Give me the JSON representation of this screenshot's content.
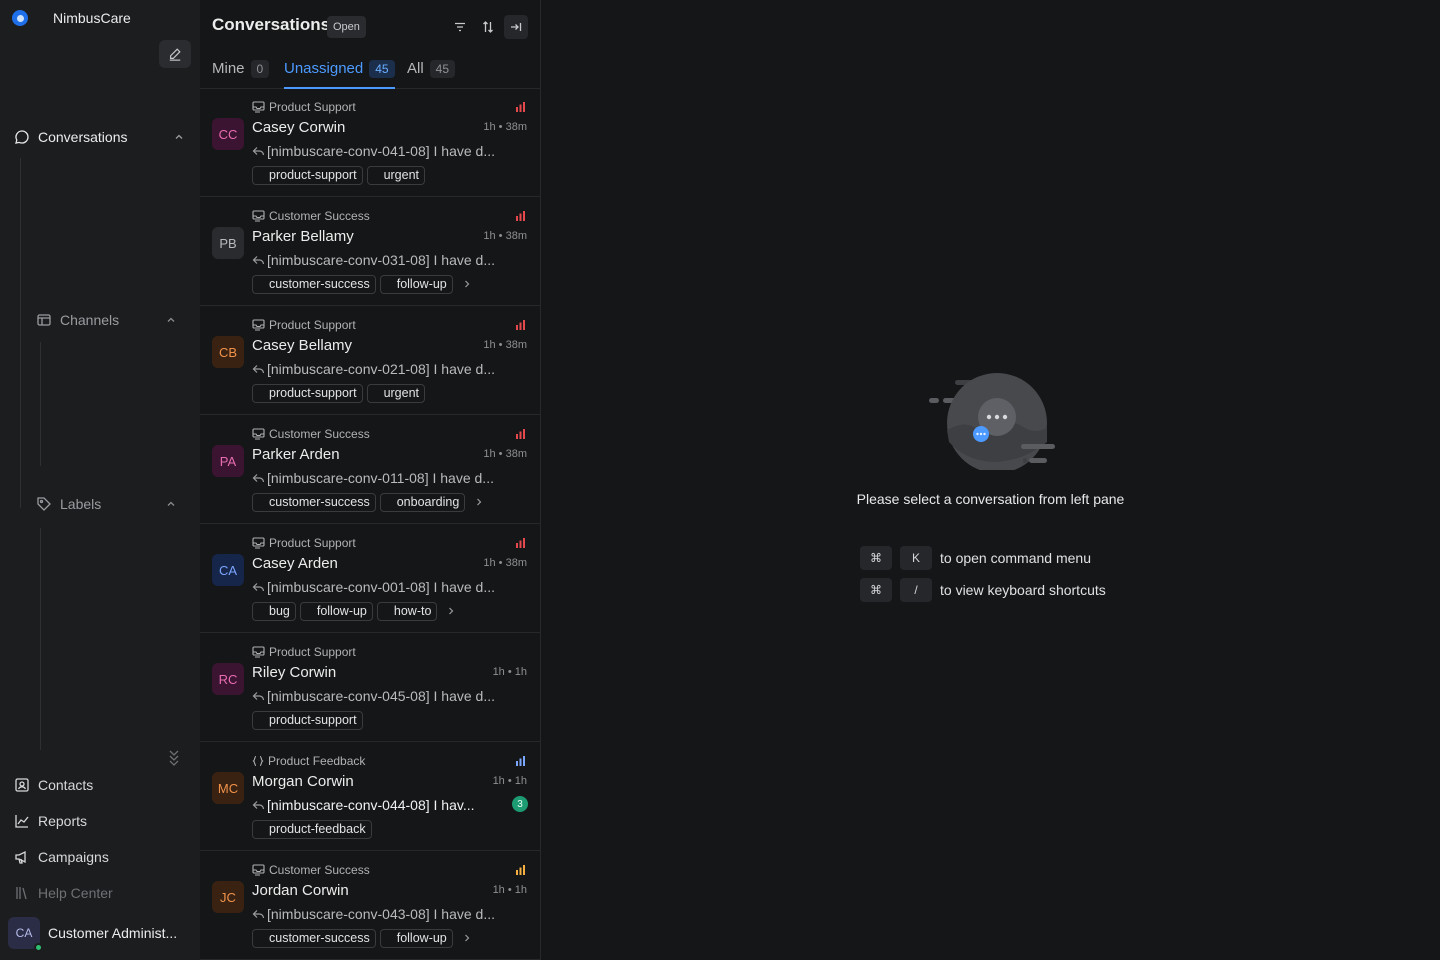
{
  "app": {
    "name": "NimbusCare"
  },
  "sidebar": {
    "compose_icon": "pencil-square-icon",
    "primary_nav": {
      "label": "Conversations",
      "icon": "chat-bubble-icon"
    },
    "groups": [
      {
        "label": "Channels",
        "icon": "inbox-icon"
      },
      {
        "label": "Labels",
        "icon": "tag-icon"
      }
    ],
    "nav_items": [
      {
        "label": "Contacts",
        "icon": "contacts-icon"
      },
      {
        "label": "Reports",
        "icon": "chart-line-icon"
      },
      {
        "label": "Campaigns",
        "icon": "megaphone-icon"
      },
      {
        "label": "Help Center",
        "icon": "library-icon"
      }
    ],
    "profile": {
      "initials": "CA",
      "name": "Customer Administ...",
      "status_color": "#2fbf71"
    }
  },
  "conversations_panel": {
    "title": "Conversations",
    "status": "Open",
    "header_icons": [
      "filter-icon",
      "sort-icon",
      "collapse-panel-icon"
    ],
    "tabs": [
      {
        "label": "Mine",
        "count": "0"
      },
      {
        "label": "Unassigned",
        "count": "45",
        "active": true
      },
      {
        "label": "All",
        "count": "45"
      }
    ],
    "items": [
      {
        "initials": "CC",
        "avatar_bg": "#3a1430",
        "avatar_fg": "#e86cb1",
        "inbox": "Product Support",
        "inbox_icon": "email-inbox-icon",
        "priority_color": "#e5484d",
        "name": "Casey Corwin",
        "time": "1h • 38m",
        "preview": "[nimbuscare-conv-041-08] I have d...",
        "labels": [
          "product-support",
          "urgent"
        ],
        "has_more": false,
        "unread": ""
      },
      {
        "initials": "PB",
        "avatar_bg": "#2a2b2e",
        "avatar_fg": "#b8babd",
        "inbox": "Customer Success",
        "inbox_icon": "email-inbox-icon",
        "priority_color": "#e5484d",
        "name": "Parker Bellamy",
        "time": "1h • 38m",
        "preview": "[nimbuscare-conv-031-08] I have d...",
        "labels": [
          "customer-success",
          "follow-up"
        ],
        "has_more": true,
        "unread": ""
      },
      {
        "initials": "CB",
        "avatar_bg": "#3a2212",
        "avatar_fg": "#f0924a",
        "inbox": "Product Support",
        "inbox_icon": "email-inbox-icon",
        "priority_color": "#e5484d",
        "name": "Casey Bellamy",
        "time": "1h • 38m",
        "preview": "[nimbuscare-conv-021-08] I have d...",
        "labels": [
          "product-support",
          "urgent"
        ],
        "has_more": false,
        "unread": ""
      },
      {
        "initials": "PA",
        "avatar_bg": "#3a1430",
        "avatar_fg": "#e86cb1",
        "inbox": "Customer Success",
        "inbox_icon": "email-inbox-icon",
        "priority_color": "#e5484d",
        "name": "Parker Arden",
        "time": "1h • 38m",
        "preview": "[nimbuscare-conv-011-08] I have d...",
        "labels": [
          "customer-success",
          "onboarding"
        ],
        "has_more": true,
        "unread": ""
      },
      {
        "initials": "CA",
        "avatar_bg": "#16254a",
        "avatar_fg": "#7aa6ff",
        "inbox": "Product Support",
        "inbox_icon": "email-inbox-icon",
        "priority_color": "#e5484d",
        "name": "Casey Arden",
        "time": "1h • 38m",
        "preview": "[nimbuscare-conv-001-08] I have d...",
        "labels": [
          "bug",
          "follow-up",
          "how-to"
        ],
        "has_more": true,
        "unread": ""
      },
      {
        "initials": "RC",
        "avatar_bg": "#3a1430",
        "avatar_fg": "#e86cb1",
        "inbox": "Product Support",
        "inbox_icon": "email-inbox-icon",
        "priority_color": "",
        "name": "Riley Corwin",
        "time": "1h • 1h",
        "preview": "[nimbuscare-conv-045-08] I have d...",
        "labels": [
          "product-support"
        ],
        "has_more": false,
        "unread": ""
      },
      {
        "initials": "MC",
        "avatar_bg": "#3a2212",
        "avatar_fg": "#f0924a",
        "inbox": "Product Feedback",
        "inbox_icon": "code-braces-icon",
        "priority_color": "#7aa6ff",
        "name": "Morgan Corwin",
        "time": "1h • 1h",
        "preview": "[nimbuscare-conv-044-08] I hav...",
        "labels": [
          "product-feedback"
        ],
        "has_more": false,
        "unread": "3"
      },
      {
        "initials": "JC",
        "avatar_bg": "#3a2212",
        "avatar_fg": "#f0924a",
        "inbox": "Customer Success",
        "inbox_icon": "email-inbox-icon",
        "priority_color": "#f5b041",
        "name": "Jordan Corwin",
        "time": "1h • 1h",
        "preview": "[nimbuscare-conv-043-08] I have d...",
        "labels": [
          "customer-success",
          "follow-up"
        ],
        "has_more": true,
        "unread": ""
      }
    ]
  },
  "empty_state": {
    "illustration_icon": "chat-bubble-illustration-icon",
    "message": "Please select a conversation from left pane",
    "shortcuts": [
      {
        "keys": [
          "⌘",
          "K"
        ],
        "text": "to open command menu"
      },
      {
        "keys": [
          "⌘",
          "/"
        ],
        "text": "to view keyboard shortcuts"
      }
    ]
  }
}
